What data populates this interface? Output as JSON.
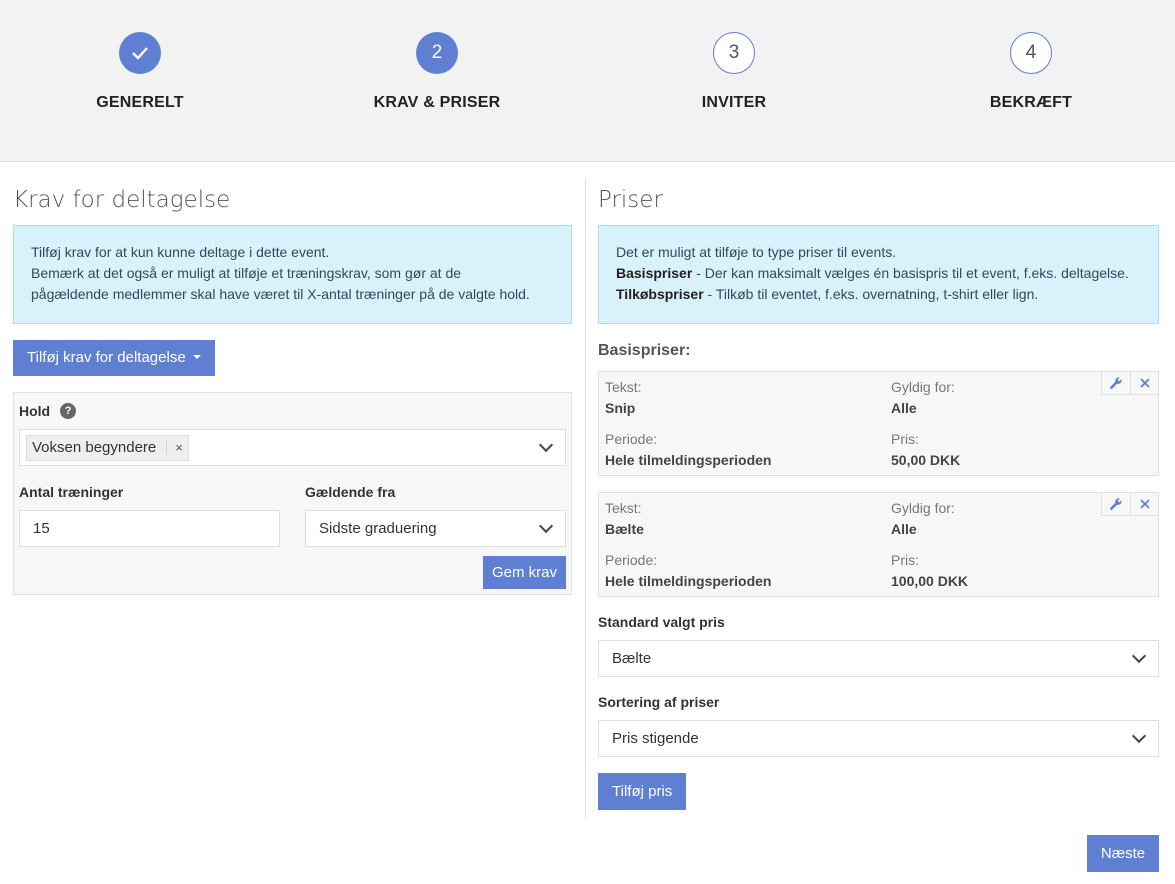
{
  "stepper": {
    "steps": [
      {
        "label": "GENERELT",
        "marker": "",
        "state": "done"
      },
      {
        "label": "KRAV & PRISER",
        "marker": "2",
        "state": "active"
      },
      {
        "label": "INVITER",
        "marker": "3",
        "state": "todo"
      },
      {
        "label": "BEKRÆFT",
        "marker": "4",
        "state": "todo"
      }
    ]
  },
  "requirements": {
    "title": "Krav for deltagelse",
    "info_lines": [
      "Tilføj krav for at kun kunne deltage i dette event.",
      "Bemærk at det også er muligt at tilføje et træningskrav, som gør at de",
      "pågældende medlemmer skal have været til X-antal træninger på de valgte hold."
    ],
    "add_button": "Tilføj krav for deltagelse",
    "hold_label": "Hold",
    "help_glyph": "?",
    "hold_tag": "Voksen begyndere",
    "tag_remove": "×",
    "trainings_label": "Antal træninger",
    "trainings_value": "15",
    "valid_from_label": "Gældende fra",
    "valid_from_value": "Sidste graduering",
    "save_button": "Gem krav"
  },
  "prices": {
    "title": "Priser",
    "info_line1": "Det er muligt at tilføje to type priser til events.",
    "info_bold2": "Basispriser",
    "info_rest2": " - Der kan maksimalt vælges én basispris til et event, f.eks. deltagelse.",
    "info_bold3": "Tilkøbspriser",
    "info_rest3": " - Tilkøb til eventet, f.eks. overnatning, t-shirt eller lign.",
    "base_heading": "Basispriser:",
    "labels": {
      "text": "Tekst:",
      "valid_for": "Gyldig for:",
      "period": "Periode:",
      "price": "Pris:"
    },
    "items": [
      {
        "text": "Snip",
        "valid_for": "Alle",
        "period": "Hele tilmeldingsperioden",
        "price": "50,00 DKK"
      },
      {
        "text": "Bælte",
        "valid_for": "Alle",
        "period": "Hele tilmeldingsperioden",
        "price": "100,00 DKK"
      }
    ],
    "default_label": "Standard valgt pris",
    "default_value": "Bælte",
    "sort_label": "Sortering af priser",
    "sort_value": "Pris stigende",
    "add_button": "Tilføj pris"
  },
  "footer": {
    "next_button": "Næste"
  },
  "colors": {
    "accent": "#5f80d2",
    "info_bg": "#d9f1fa",
    "panel_bg": "#f7f7f7"
  },
  "icons": [
    "check-icon",
    "help-icon",
    "chevron-down-icon",
    "caret-down-icon",
    "wrench-icon",
    "close-icon"
  ]
}
